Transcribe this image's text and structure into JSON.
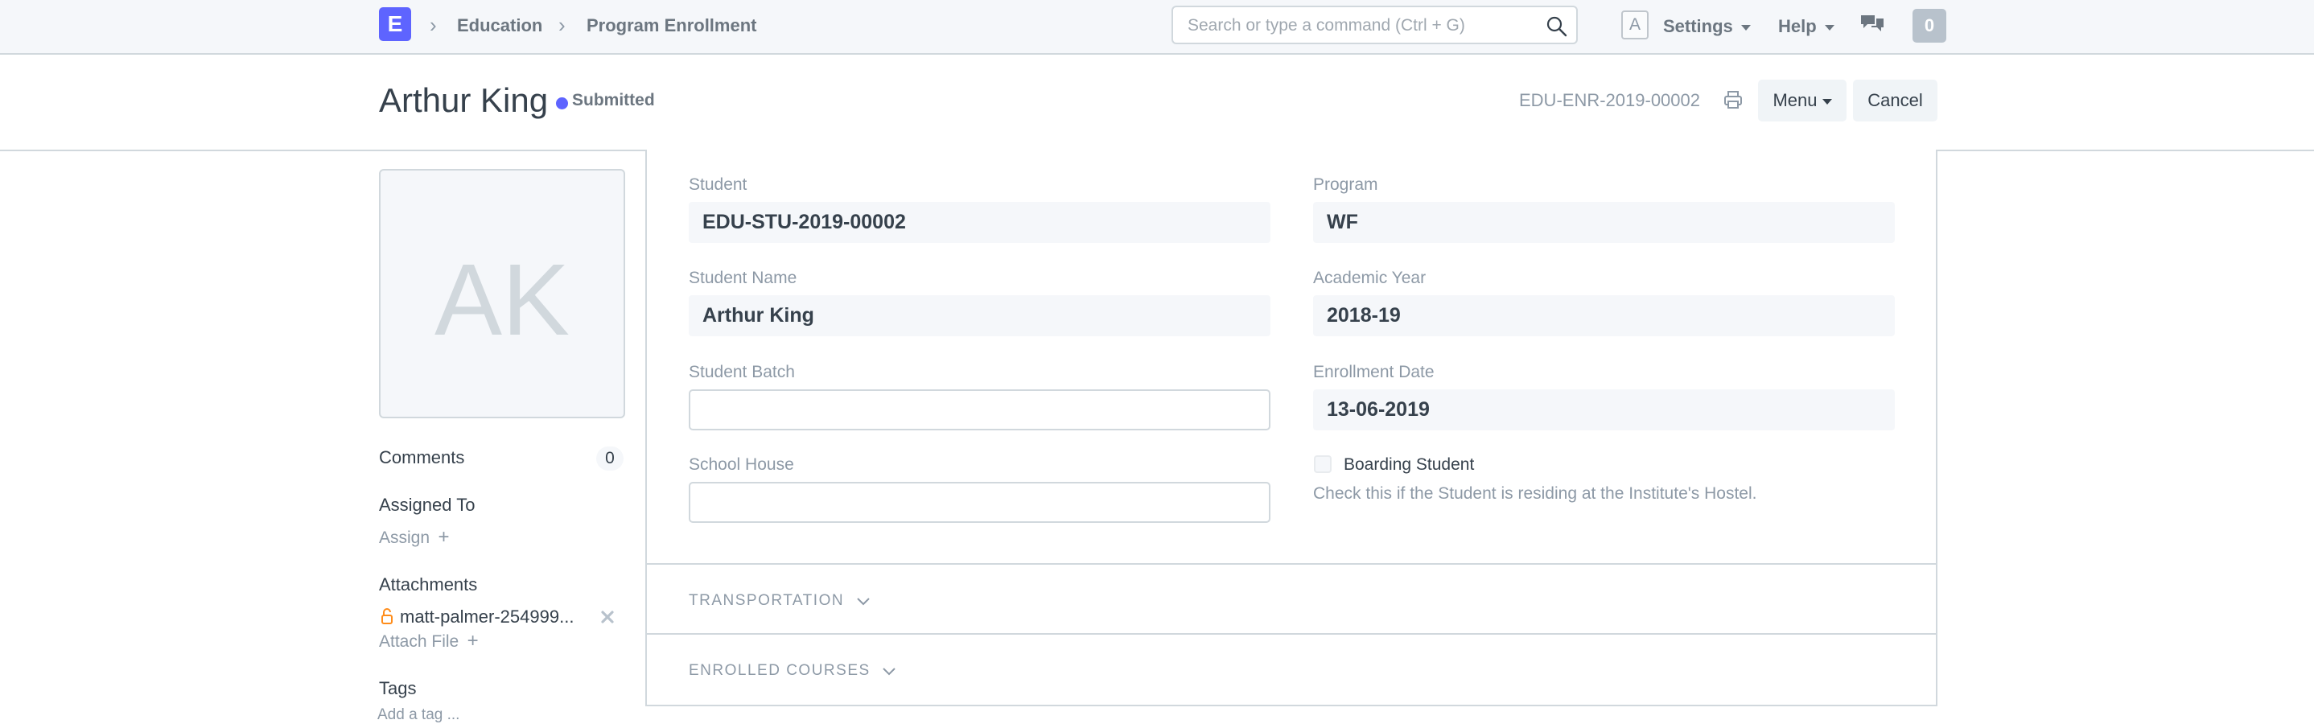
{
  "navbar": {
    "logo_letter": "E",
    "breadcrumbs": [
      "Education",
      "Program Enrollment"
    ],
    "search_placeholder": "Search or type a command (Ctrl + G)",
    "avatar_letter": "A",
    "settings_label": "Settings",
    "help_label": "Help",
    "notification_count": "0"
  },
  "page_head": {
    "title": "Arthur King",
    "status": "Submitted",
    "status_color": "#5e64ff",
    "doc_name": "EDU-ENR-2019-00002",
    "menu_label": "Menu",
    "cancel_label": "Cancel"
  },
  "sidebar": {
    "initials": "AK",
    "comments_label": "Comments",
    "comments_count": "0",
    "assigned_to_label": "Assigned To",
    "assign_label": "Assign",
    "attachments_label": "Attachments",
    "attachment_name": "matt-palmer-254999...",
    "attach_file_label": "Attach File",
    "tags_label": "Tags",
    "add_tag_label": "Add a tag ..."
  },
  "form": {
    "student_label": "Student",
    "student_value": "EDU-STU-2019-00002",
    "student_name_label": "Student Name",
    "student_name_value": "Arthur King",
    "student_batch_label": "Student Batch",
    "student_batch_value": "",
    "school_house_label": "School House",
    "school_house_value": "",
    "program_label": "Program",
    "program_value": "WF",
    "academic_year_label": "Academic Year",
    "academic_year_value": "2018-19",
    "enrollment_date_label": "Enrollment Date",
    "enrollment_date_value": "13-06-2019",
    "boarding_label": "Boarding Student",
    "boarding_checked": false,
    "boarding_help": "Check this if the Student is residing at the Institute's Hostel."
  },
  "sections": {
    "transportation": "TRANSPORTATION",
    "enrolled_courses": "ENROLLED COURSES"
  }
}
